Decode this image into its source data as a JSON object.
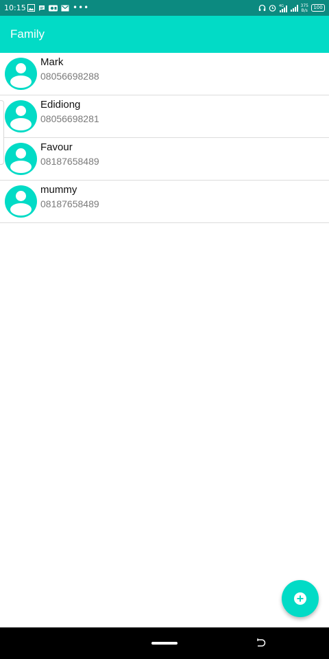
{
  "status_bar": {
    "time": "10:15",
    "more": "•••",
    "speed_value": "375",
    "speed_unit": "B/s",
    "battery": "100",
    "icons": [
      "image-icon",
      "message-icon",
      "video-icon",
      "mail-icon",
      "headphones-icon",
      "alarm-icon",
      "signal-4g-icon",
      "signal-icon",
      "battery-icon"
    ]
  },
  "app_bar": {
    "title": "Family"
  },
  "contacts": [
    {
      "name": "Mark",
      "phone": "08056698288"
    },
    {
      "name": "Edidiong",
      "phone": "08056698281"
    },
    {
      "name": "Favour",
      "phone": "08187658489"
    },
    {
      "name": "mummy",
      "phone": "08187658489"
    }
  ],
  "fab": {
    "icon": "add-circle-icon"
  },
  "nav_bar": {
    "icons": [
      "home-pill",
      "back-icon"
    ]
  },
  "colors": {
    "status_bar": "#0c8a80",
    "accent": "#02dbc6",
    "divider": "#dcdcdc",
    "name_text": "#111111",
    "phone_text": "#7a7a7a",
    "nav_bar": "#000000"
  }
}
